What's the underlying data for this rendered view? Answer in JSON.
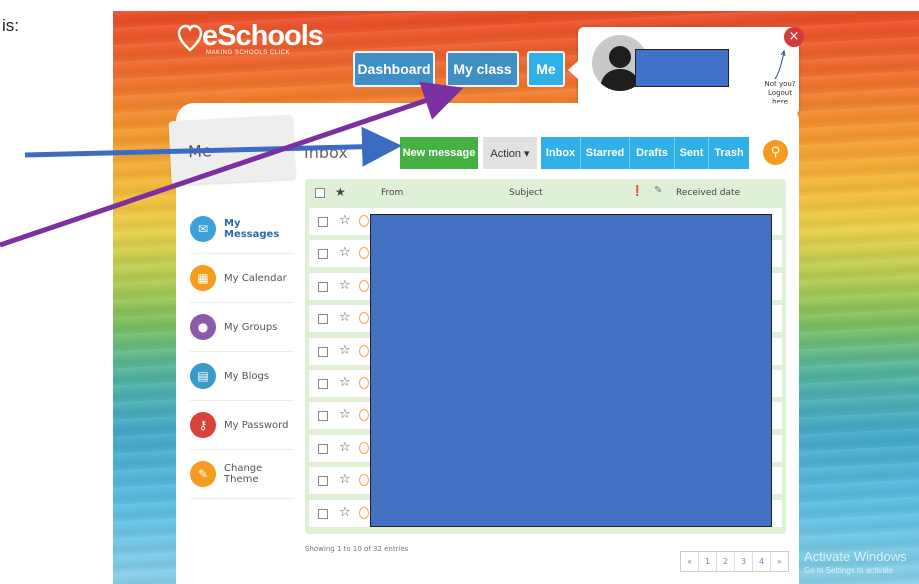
{
  "intro_text": "is:",
  "app": {
    "brand": "eSchools",
    "tagline": "MAKING SCHOOLS CLICK",
    "accent_blue": "#3f8fc5",
    "accent_green": "#46b142",
    "accent_cyan": "#2fb0e6"
  },
  "nav": {
    "dashboard": "Dashboard",
    "my_class": "My class",
    "me": "Me"
  },
  "user_popup": {
    "logout": "Not you? Logout here",
    "close_icon": "close-icon"
  },
  "me_tab": "Me",
  "inbox": {
    "title": "Inbox",
    "new_message": "New message",
    "action": "Action ▾",
    "filters": [
      "Inbox",
      "Starred",
      "Drafts",
      "Sent",
      "Trash"
    ],
    "columns": {
      "from": "From",
      "subject": "Subject",
      "received": "Received date"
    },
    "row_count": 10,
    "entries_text": "Showing 1 to 10 of 32 entries",
    "pagination": [
      "«",
      "1",
      "2",
      "3",
      "4",
      "»"
    ]
  },
  "sidebar": {
    "items": [
      {
        "label": "My Messages",
        "icon": "envelope-icon",
        "color": "#3aa2d8",
        "glyph": "✉"
      },
      {
        "label": "My Calendar",
        "icon": "calendar-icon",
        "color": "#f39c1f",
        "glyph": "▦"
      },
      {
        "label": "My Groups",
        "icon": "group-icon",
        "color": "#8b5aa8",
        "glyph": "●"
      },
      {
        "label": "My Blogs",
        "icon": "blog-icon",
        "color": "#3a9bc6",
        "glyph": "▤"
      },
      {
        "label": "My Password",
        "icon": "key-icon",
        "color": "#d9423a",
        "glyph": "⚷"
      },
      {
        "label": "Change Theme",
        "icon": "pencil-icon",
        "color": "#f39c1f",
        "glyph": "✎"
      }
    ]
  },
  "watermark": {
    "line1": "Activate Windows",
    "line2": "Go to Settings to activate"
  },
  "annotation_color": "#7b2fa0",
  "annotation_color2": "#3a6cc4"
}
